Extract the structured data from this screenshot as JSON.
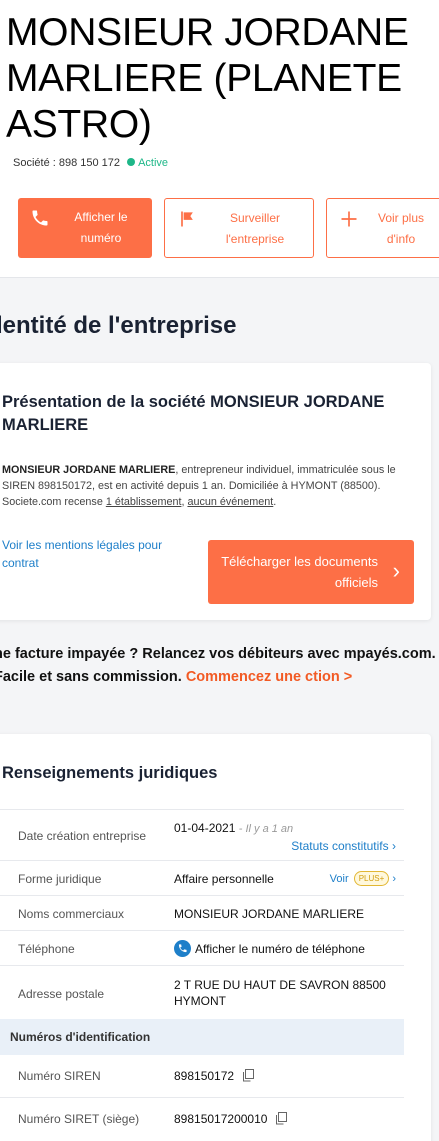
{
  "header": {
    "title": "MONSIEUR JORDANE MARLIERE (PLANETE ASTRO)",
    "siren_line": "Société : 898 150 172",
    "status": "Active"
  },
  "actions": {
    "show_number": "Afficher le numéro",
    "watch": "Surveiller l'entreprise",
    "more_info": "Voir plus d'info"
  },
  "section_title": "dentité de l'entreprise",
  "presentation": {
    "title": "Présentation de la société MONSIEUR JORDANE MARLIERE",
    "company_name": "MONSIEUR JORDANE MARLIERE",
    "text_1": ", entrepreneur individuel, immatriculée sous le SIREN 898150172, est en activité depuis 1 an. Domiciliée à HYMONT (88500). Societe.com recense ",
    "link_establishment": "1 établissement",
    "text_2": ", ",
    "link_events": "aucun événement",
    "text_3": ".",
    "legal_link": "Voir les mentions légales pour contrat",
    "download_button": "Télécharger les documents officiels"
  },
  "promo": {
    "text": "ne facture impayée ? Relancez vos débiteurs avec mpayés.com. Facile et sans commission. ",
    "cta": "Commencez une ction >"
  },
  "legal": {
    "title": "Renseignements juridiques",
    "creation_label": "Date création entreprise",
    "creation_value": "01-04-2021",
    "creation_ago": "- Il y a 1 an",
    "statuts_link": "Statuts constitutifs",
    "forme_label": "Forme juridique",
    "forme_value": "Affaire personnelle",
    "voir_link": "Voir",
    "plus_badge": "PLUS+",
    "noms_label": "Noms commerciaux",
    "noms_value": "MONSIEUR JORDANE MARLIERE",
    "tel_label": "Téléphone",
    "tel_link": "Afficher le numéro de téléphone",
    "adresse_label": "Adresse postale",
    "adresse_value": "2 T RUE DU HAUT DE SAVRON 88500 HYMONT",
    "ids_header": "Numéros d'identification",
    "siren_label": "Numéro SIREN",
    "siren_value": "898150172",
    "siret_label": "Numéro SIRET (siège)",
    "siret_value": "89815017200010"
  },
  "colors": {
    "accent": "#fd6f46",
    "active": "#1eb788",
    "link": "#1e7fc9"
  }
}
